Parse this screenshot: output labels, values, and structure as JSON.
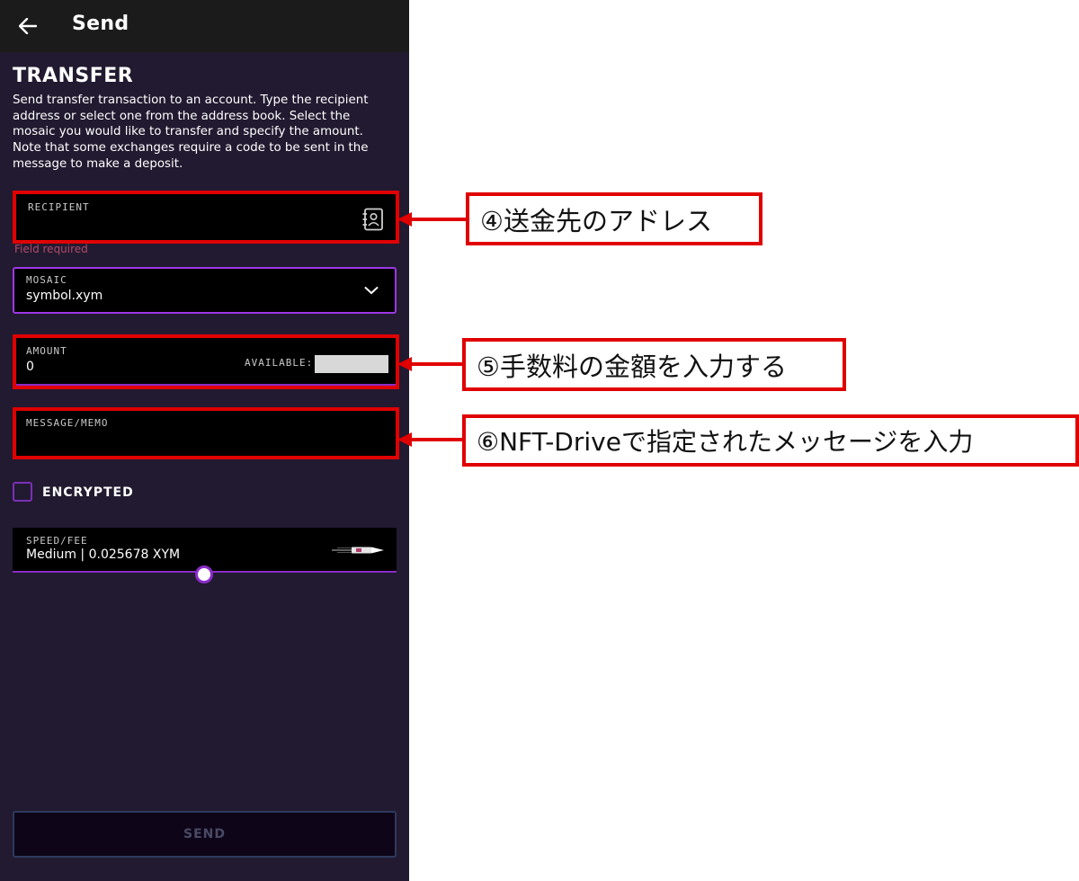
{
  "appbar": {
    "title": "Send",
    "back_icon": "arrow-left-icon"
  },
  "transfer": {
    "heading": "TRANSFER",
    "description": "Send transfer transaction to an account. Type the recipient address or select one from the address book. Select the mosaic you would like to transfer and specify the amount. Note that some exchanges require a code to be sent in the message to make a deposit."
  },
  "recipient": {
    "label": "RECIPIENT",
    "value": "",
    "hint": "Field required",
    "icon": "address-book-icon"
  },
  "mosaic": {
    "label": "MOSAIC",
    "value": "symbol.xym",
    "icon": "chevron-down-icon"
  },
  "amount": {
    "label": "AMOUNT",
    "value": "0",
    "available_label": "AVAILABLE:"
  },
  "message": {
    "label": "MESSAGE/MEMO",
    "value": ""
  },
  "encrypted": {
    "label": "ENCRYPTED",
    "checked": false
  },
  "speed": {
    "label": "SPEED/FEE",
    "value": "Medium | 0.025678 XYM",
    "icon": "rocket-icon",
    "level": 0.5
  },
  "send_button": {
    "label": "SEND"
  },
  "annotations": [
    {
      "text": "④送金先のアドレス"
    },
    {
      "text": "⑤手数料の金額を入力する"
    },
    {
      "text": "⑥NFT-Driveで指定されたメッセージを入力"
    }
  ],
  "colors": {
    "background": "#221a30",
    "appbar": "#1b1b1b",
    "accent": "#9d37e6",
    "annotation": "#e00000"
  }
}
